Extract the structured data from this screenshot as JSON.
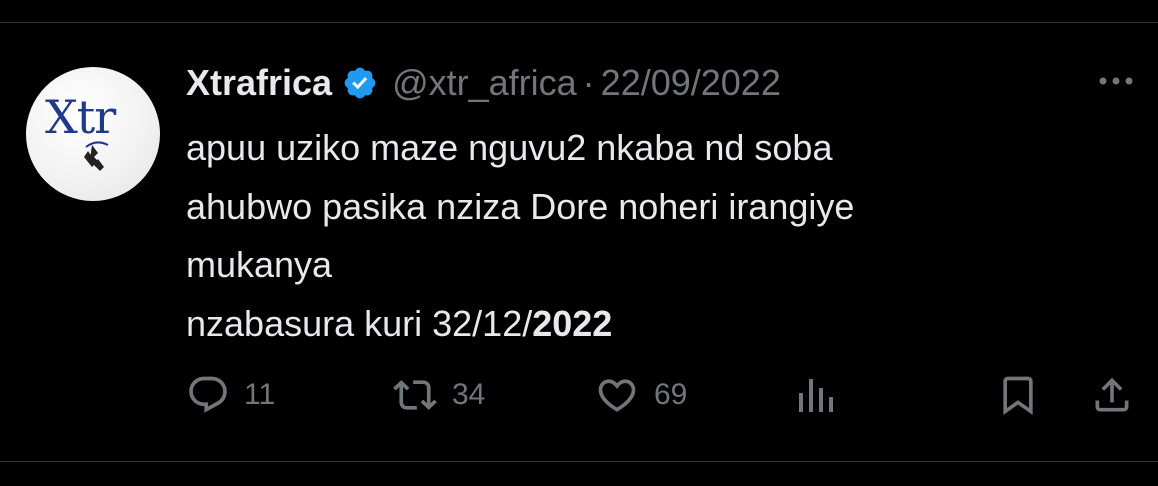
{
  "tweet": {
    "author_name": "Xtrafrica",
    "handle": "@xtr_africa",
    "separator": "·",
    "date": "22/09/2022",
    "verified": true,
    "avatar_text": "Xtr",
    "body_lines": [
      "apuu uziko maze nguvu2 nkaba nd soba",
      "ahubwo pasika nziza Dore noheri irangiye",
      "mukanya"
    ],
    "last_line_prefix": "nzabasura kuri 32/12/",
    "last_line_bold": "2022"
  },
  "actions": {
    "replies": "11",
    "retweets": "34",
    "likes": "69"
  },
  "icons": {
    "verified": "verified-badge-icon",
    "more": "more-dots-icon",
    "reply": "reply-icon",
    "retweet": "retweet-icon",
    "like": "heart-icon",
    "views": "views-chart-icon",
    "bookmark": "bookmark-icon",
    "share": "share-icon"
  },
  "colors": {
    "background": "#000000",
    "text": "#e7e9ea",
    "muted": "#71767b",
    "verified_blue": "#1d9bf0",
    "logo_blue": "#1f3a8a"
  }
}
